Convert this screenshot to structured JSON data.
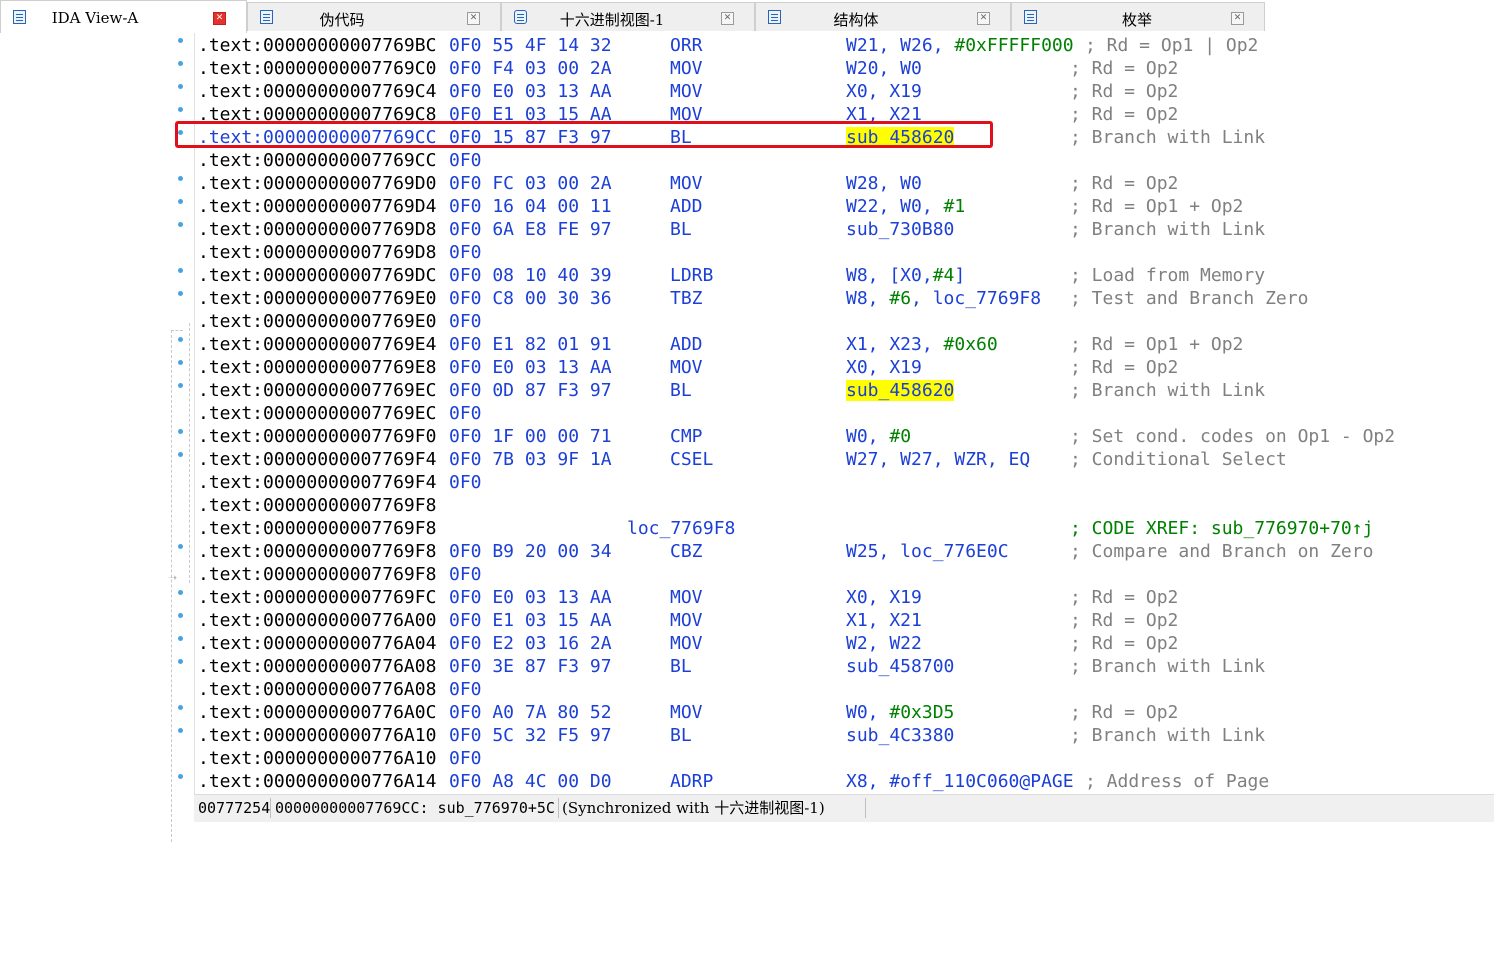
{
  "tabs": [
    {
      "label": "IDA View-A",
      "active": true
    },
    {
      "label": "伪代码",
      "active": false
    },
    {
      "label": "十六进制视图-1",
      "active": false
    },
    {
      "label": "结构体",
      "active": false
    },
    {
      "label": "枚举",
      "active": false
    }
  ],
  "close_glyph": "✕",
  "listing": [
    {
      "addr": ".text:00000000007769BC",
      "bytes": "0F0 55 4F 14 32",
      "mnemonic": "ORR",
      "op": "W21, W26, ",
      "op_imm": "#0xFFFFF000",
      "op_tail": "",
      "comment": "; Rd = Op1 | Op2"
    },
    {
      "addr": ".text:00000000007769C0",
      "bytes": "0F0 F4 03 00 2A",
      "mnemonic": "MOV",
      "op": "W20, W0",
      "comment": "; Rd = Op2"
    },
    {
      "addr": ".text:00000000007769C4",
      "bytes": "0F0 E0 03 13 AA",
      "mnemonic": "MOV",
      "op": "X0, X19",
      "comment": "; Rd = Op2"
    },
    {
      "addr": ".text:00000000007769C8",
      "bytes": "0F0 E1 03 15 AA",
      "mnemonic": "MOV",
      "op": "X1, X21",
      "comment": "; Rd = Op2"
    },
    {
      "addr": ".text:00000000007769CC",
      "bytes": "0F0 15 87 F3 97",
      "mnemonic": "BL",
      "op_hl": "sub_458620",
      "comment": "; Branch with Link",
      "current": true
    },
    {
      "addr": ".text:00000000007769CC",
      "bytes": "0F0"
    },
    {
      "addr": ".text:00000000007769D0",
      "bytes": "0F0 FC 03 00 2A",
      "mnemonic": "MOV",
      "op": "W28, W0",
      "comment": "; Rd = Op2"
    },
    {
      "addr": ".text:00000000007769D4",
      "bytes": "0F0 16 04 00 11",
      "mnemonic": "ADD",
      "op": "W22, W0, ",
      "op_imm": "#1",
      "op_tail": "",
      "comment": "; Rd = Op1 + Op2"
    },
    {
      "addr": ".text:00000000007769D8",
      "bytes": "0F0 6A E8 FE 97",
      "mnemonic": "BL",
      "op": "sub_730B80",
      "comment": "; Branch with Link"
    },
    {
      "addr": ".text:00000000007769D8",
      "bytes": "0F0"
    },
    {
      "addr": ".text:00000000007769DC",
      "bytes": "0F0 08 10 40 39",
      "mnemonic": "LDRB",
      "op": "W8, [X0,",
      "op_imm": "#4",
      "op_tail": "]",
      "comment": "; Load from Memory"
    },
    {
      "addr": ".text:00000000007769E0",
      "bytes": "0F0 C8 00 30 36",
      "mnemonic": "TBZ",
      "op": "W8, ",
      "op_imm": "#6",
      "op_tail": ", loc_7769F8",
      "comment": "; Test and Branch Zero"
    },
    {
      "addr": ".text:00000000007769E0",
      "bytes": "0F0"
    },
    {
      "addr": ".text:00000000007769E4",
      "bytes": "0F0 E1 82 01 91",
      "mnemonic": "ADD",
      "op": "X1, X23, ",
      "op_imm": "#0x60",
      "op_tail": "",
      "comment": "; Rd = Op1 + Op2"
    },
    {
      "addr": ".text:00000000007769E8",
      "bytes": "0F0 E0 03 13 AA",
      "mnemonic": "MOV",
      "op": "X0, X19",
      "comment": "; Rd = Op2"
    },
    {
      "addr": ".text:00000000007769EC",
      "bytes": "0F0 0D 87 F3 97",
      "mnemonic": "BL",
      "op_hl": "sub_458620",
      "comment": "; Branch with Link"
    },
    {
      "addr": ".text:00000000007769EC",
      "bytes": "0F0"
    },
    {
      "addr": ".text:00000000007769F0",
      "bytes": "0F0 1F 00 00 71",
      "mnemonic": "CMP",
      "op": "W0, ",
      "op_imm": "#0",
      "op_tail": "",
      "comment": "; Set cond. codes on Op1 - Op2"
    },
    {
      "addr": ".text:00000000007769F4",
      "bytes": "0F0 7B 03 9F 1A",
      "mnemonic": "CSEL",
      "op": "W27, W27, WZR, EQ",
      "comment": "; Conditional Select"
    },
    {
      "addr": ".text:00000000007769F4",
      "bytes": "0F0"
    },
    {
      "addr": ".text:00000000007769F8"
    },
    {
      "addr": ".text:00000000007769F8",
      "label": "loc_7769F8",
      "xref": "; CODE XREF: sub_776970+70↑j"
    },
    {
      "addr": ".text:00000000007769F8",
      "bytes": "0F0 B9 20 00 34",
      "mnemonic": "CBZ",
      "op": "W25, loc_776E0C",
      "comment": "; Compare and Branch on Zero"
    },
    {
      "addr": ".text:00000000007769F8",
      "bytes": "0F0"
    },
    {
      "addr": ".text:00000000007769FC",
      "bytes": "0F0 E0 03 13 AA",
      "mnemonic": "MOV",
      "op": "X0, X19",
      "comment": "; Rd = Op2"
    },
    {
      "addr": ".text:0000000000776A00",
      "bytes": "0F0 E1 03 15 AA",
      "mnemonic": "MOV",
      "op": "X1, X21",
      "comment": "; Rd = Op2"
    },
    {
      "addr": ".text:0000000000776A04",
      "bytes": "0F0 E2 03 16 2A",
      "mnemonic": "MOV",
      "op": "W2, W22",
      "comment": "; Rd = Op2"
    },
    {
      "addr": ".text:0000000000776A08",
      "bytes": "0F0 3E 87 F3 97",
      "mnemonic": "BL",
      "op": "sub_458700",
      "comment": "; Branch with Link"
    },
    {
      "addr": ".text:0000000000776A08",
      "bytes": "0F0"
    },
    {
      "addr": ".text:0000000000776A0C",
      "bytes": "0F0 A0 7A 80 52",
      "mnemonic": "MOV",
      "op": "W0, ",
      "op_imm": "#0x3D5",
      "op_tail": "",
      "comment": "; Rd = Op2"
    },
    {
      "addr": ".text:0000000000776A10",
      "bytes": "0F0 5C 32 F5 97",
      "mnemonic": "BL",
      "op": "sub_4C3380",
      "comment": "; Branch with Link"
    },
    {
      "addr": ".text:0000000000776A10",
      "bytes": "0F0"
    },
    {
      "addr": ".text:0000000000776A14",
      "bytes": "0F0 A8 4C 00 D0",
      "mnemonic": "ADRP",
      "op": "X8, #off_110C060@PAGE",
      "comment": "; Address of Page"
    }
  ],
  "status": {
    "offset": "00777254",
    "location": "00000000007769CC: sub_776970+5C",
    "sync": "(Synchronized with 十六进制视图-1)"
  },
  "colors": {
    "code_blue": "#1c3fd6",
    "immediate_green": "#008000",
    "comment_gray": "#808080",
    "highlight_yellow": "#ffff00",
    "selection_box_red": "#e0101a",
    "breakpoint_dot": "#4aa3df"
  },
  "icons": {
    "tab_icon": "view-icon",
    "tab_close": "close-icon"
  }
}
